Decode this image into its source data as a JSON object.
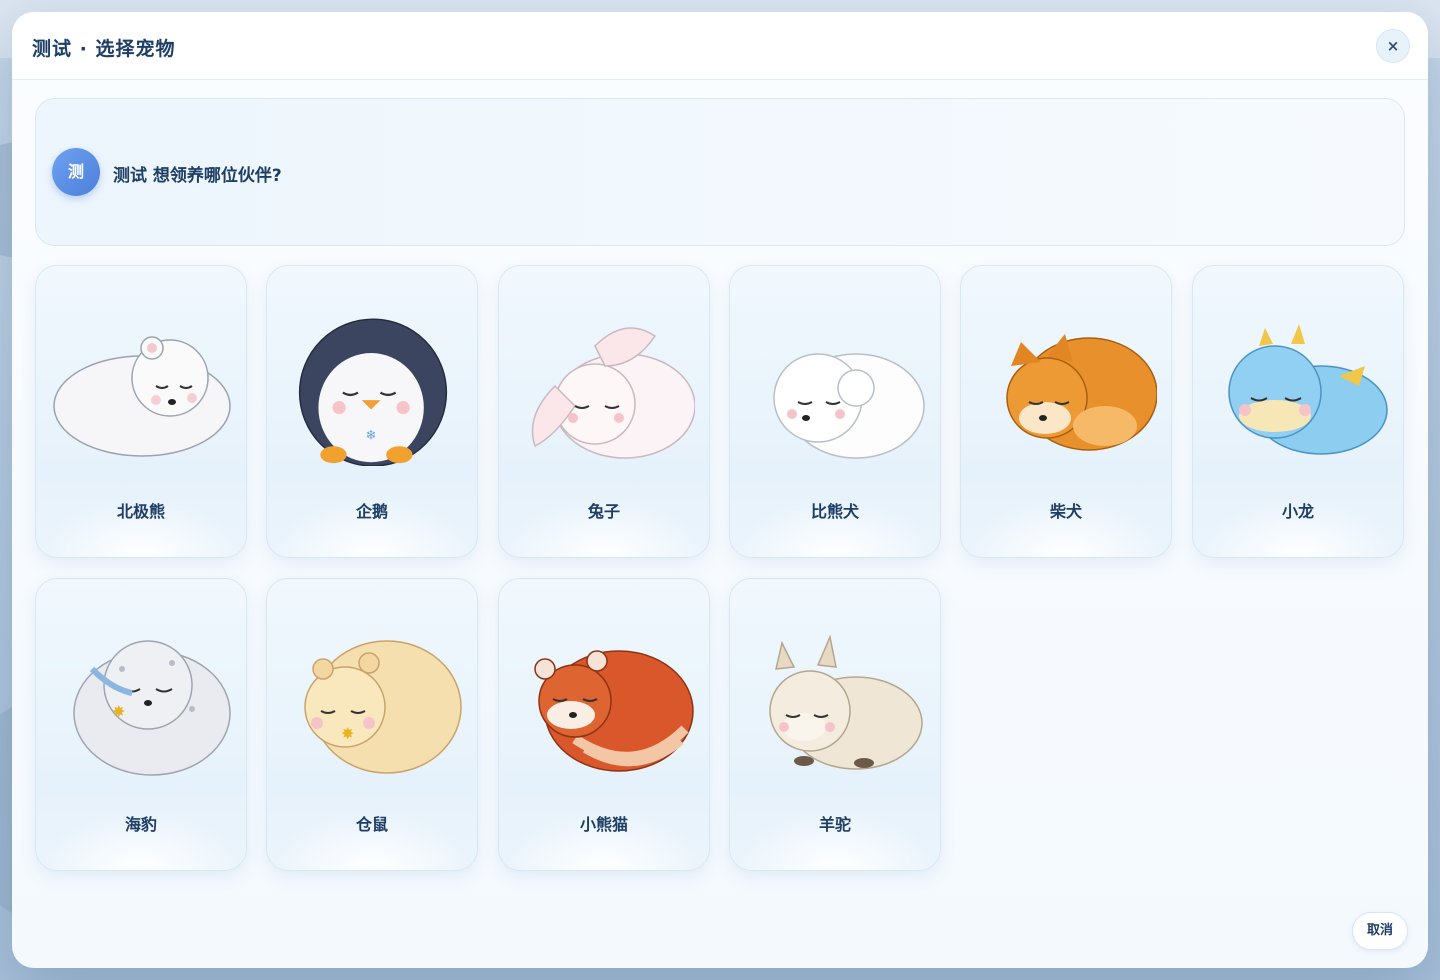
{
  "dialog": {
    "title": "测试 · 选择宠物",
    "close_label": "×",
    "cancel_label": "取消"
  },
  "prompt": {
    "avatar_text": "测",
    "question": "测试 想领养哪位伙伴?"
  },
  "pets": [
    {
      "name": "北极熊",
      "icon": "polar-bear-icon",
      "color": "#f4f4f6"
    },
    {
      "name": "企鹅",
      "icon": "penguin-icon",
      "color": "#3b4560"
    },
    {
      "name": "兔子",
      "icon": "rabbit-icon",
      "color": "#faeff1"
    },
    {
      "name": "比熊犬",
      "icon": "bichon-icon",
      "color": "#fbfbfb"
    },
    {
      "name": "柴犬",
      "icon": "shiba-icon",
      "color": "#e8902c"
    },
    {
      "name": "小龙",
      "icon": "dragon-icon",
      "color": "#7cc4ea"
    },
    {
      "name": "海豹",
      "icon": "seal-icon",
      "color": "#e6e8ee"
    },
    {
      "name": "仓鼠",
      "icon": "hamster-icon",
      "color": "#f6dfae"
    },
    {
      "name": "小熊猫",
      "icon": "red-panda-icon",
      "color": "#d9572a"
    },
    {
      "name": "羊驼",
      "icon": "alpaca-icon",
      "color": "#efe6d6"
    }
  ]
}
